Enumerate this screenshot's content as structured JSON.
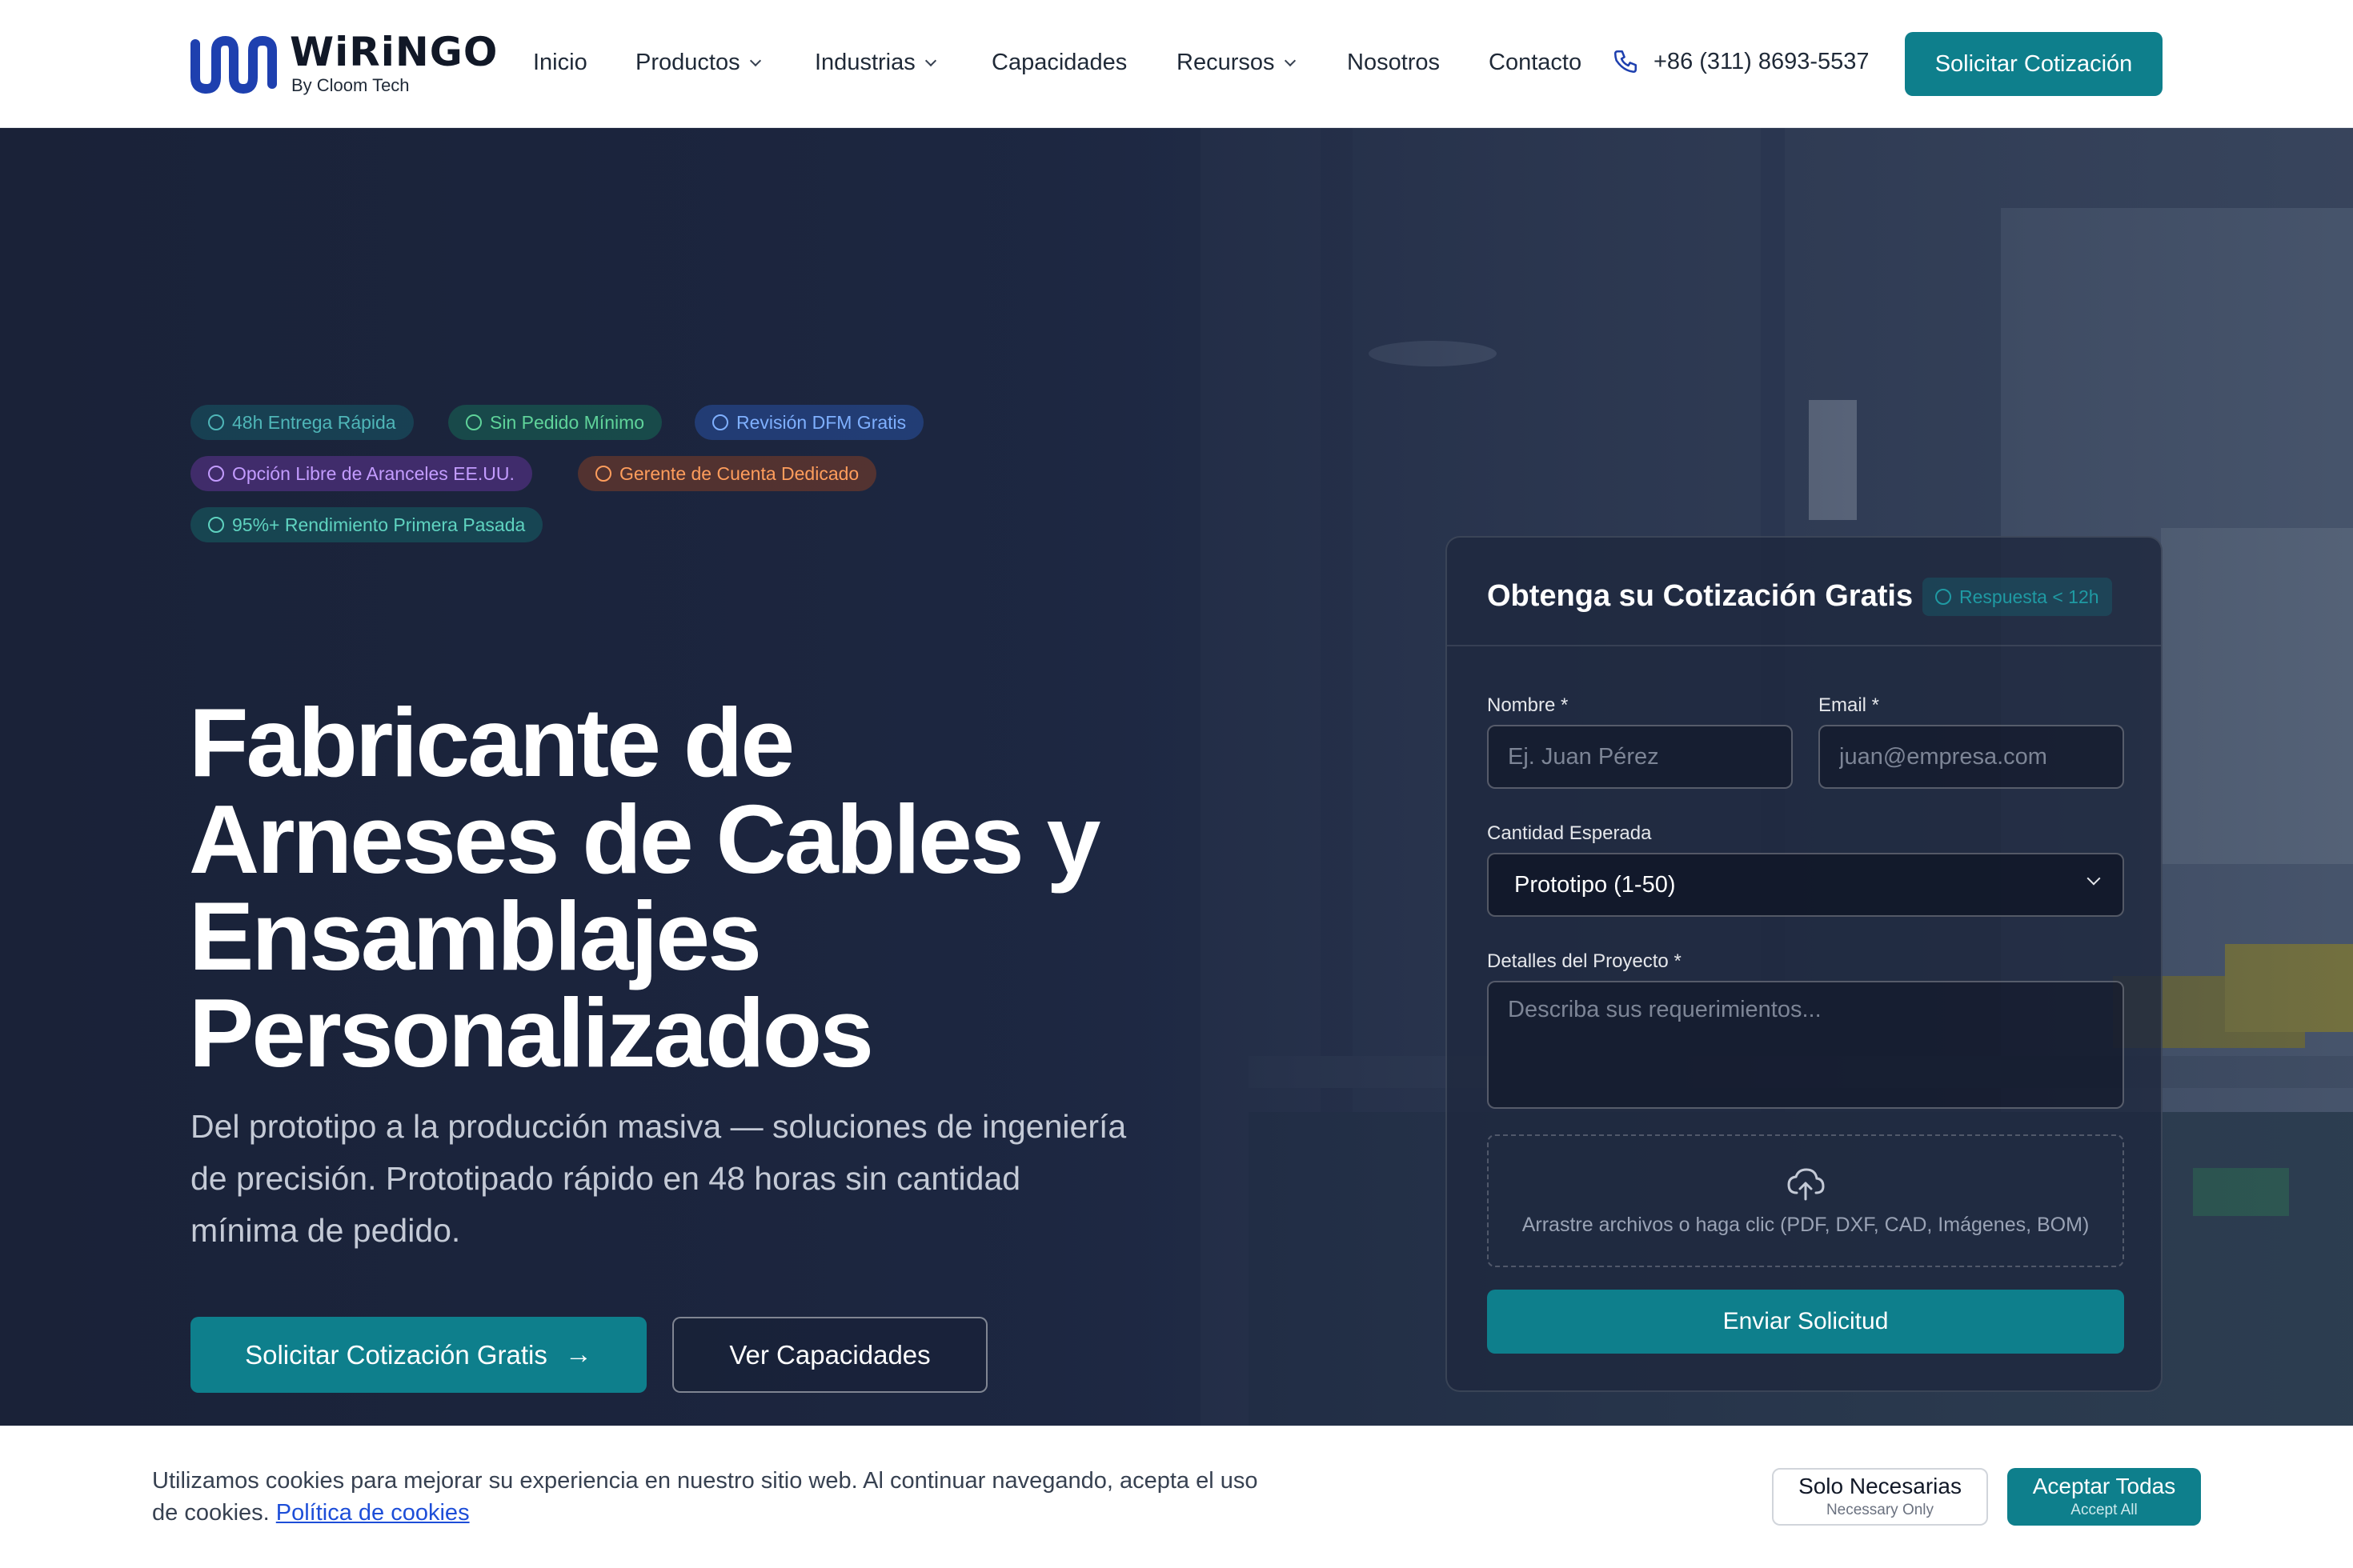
{
  "header": {
    "logo_name": "WiRiNGO",
    "logo_sub": "By Cloom Tech",
    "nav": [
      "Inicio",
      "Productos",
      "Industrias",
      "Capacidades",
      "Recursos",
      "Nosotros",
      "Contacto"
    ],
    "phone": "+86 (311) 8693-5537",
    "cta": "Solicitar Cotización"
  },
  "hero": {
    "badges": [
      "48h Entrega Rápida",
      "Sin Pedido Mínimo",
      "Revisión DFM Gratis",
      "Opción Libre de Aranceles EE.UU.",
      "Gerente de Cuenta Dedicado",
      "95%+ Rendimiento Primera Pasada"
    ],
    "title_lines": [
      "Fabricante de",
      "Arneses de Cables y",
      "Ensamblajes",
      "Personalizados"
    ],
    "subtitle": "Del prototipo a la producción masiva — soluciones de ingeniería de precisión. Prototipado rápido en 48 horas sin cantidad mínima de pedido.",
    "primary_cta": "Solicitar Cotización Gratis",
    "secondary_cta": "Ver Capacidades"
  },
  "form": {
    "title": "Obtenga su Cotización Gratis",
    "response_badge": "Respuesta < 12h",
    "name_label": "Nombre *",
    "name_placeholder": "Ej. Juan Pérez",
    "email_label": "Email *",
    "email_placeholder": "juan@empresa.com",
    "qty_label": "Cantidad Esperada",
    "qty_value": "Prototipo (1-50)",
    "details_label": "Detalles del Proyecto *",
    "details_placeholder": "Describa sus requerimientos...",
    "upload_text": "Arrastre archivos o haga clic (PDF, DXF, CAD, Imágenes, BOM)",
    "submit": "Enviar Solicitud"
  },
  "cookie": {
    "text": "Utilizamos cookies para mejorar su experiencia en nuestro sitio web. Al continuar navegando, acepta el uso de cookies.",
    "link": "Política de cookies",
    "necessary_main": "Solo Necesarias",
    "necessary_sub": "Necessary Only",
    "accept_main": "Aceptar Todas",
    "accept_sub": "Accept All"
  },
  "colors": {
    "brand_teal": "#0e7f8c",
    "logo_blue": "#1e40af",
    "hero_bg": "#1a2238"
  }
}
